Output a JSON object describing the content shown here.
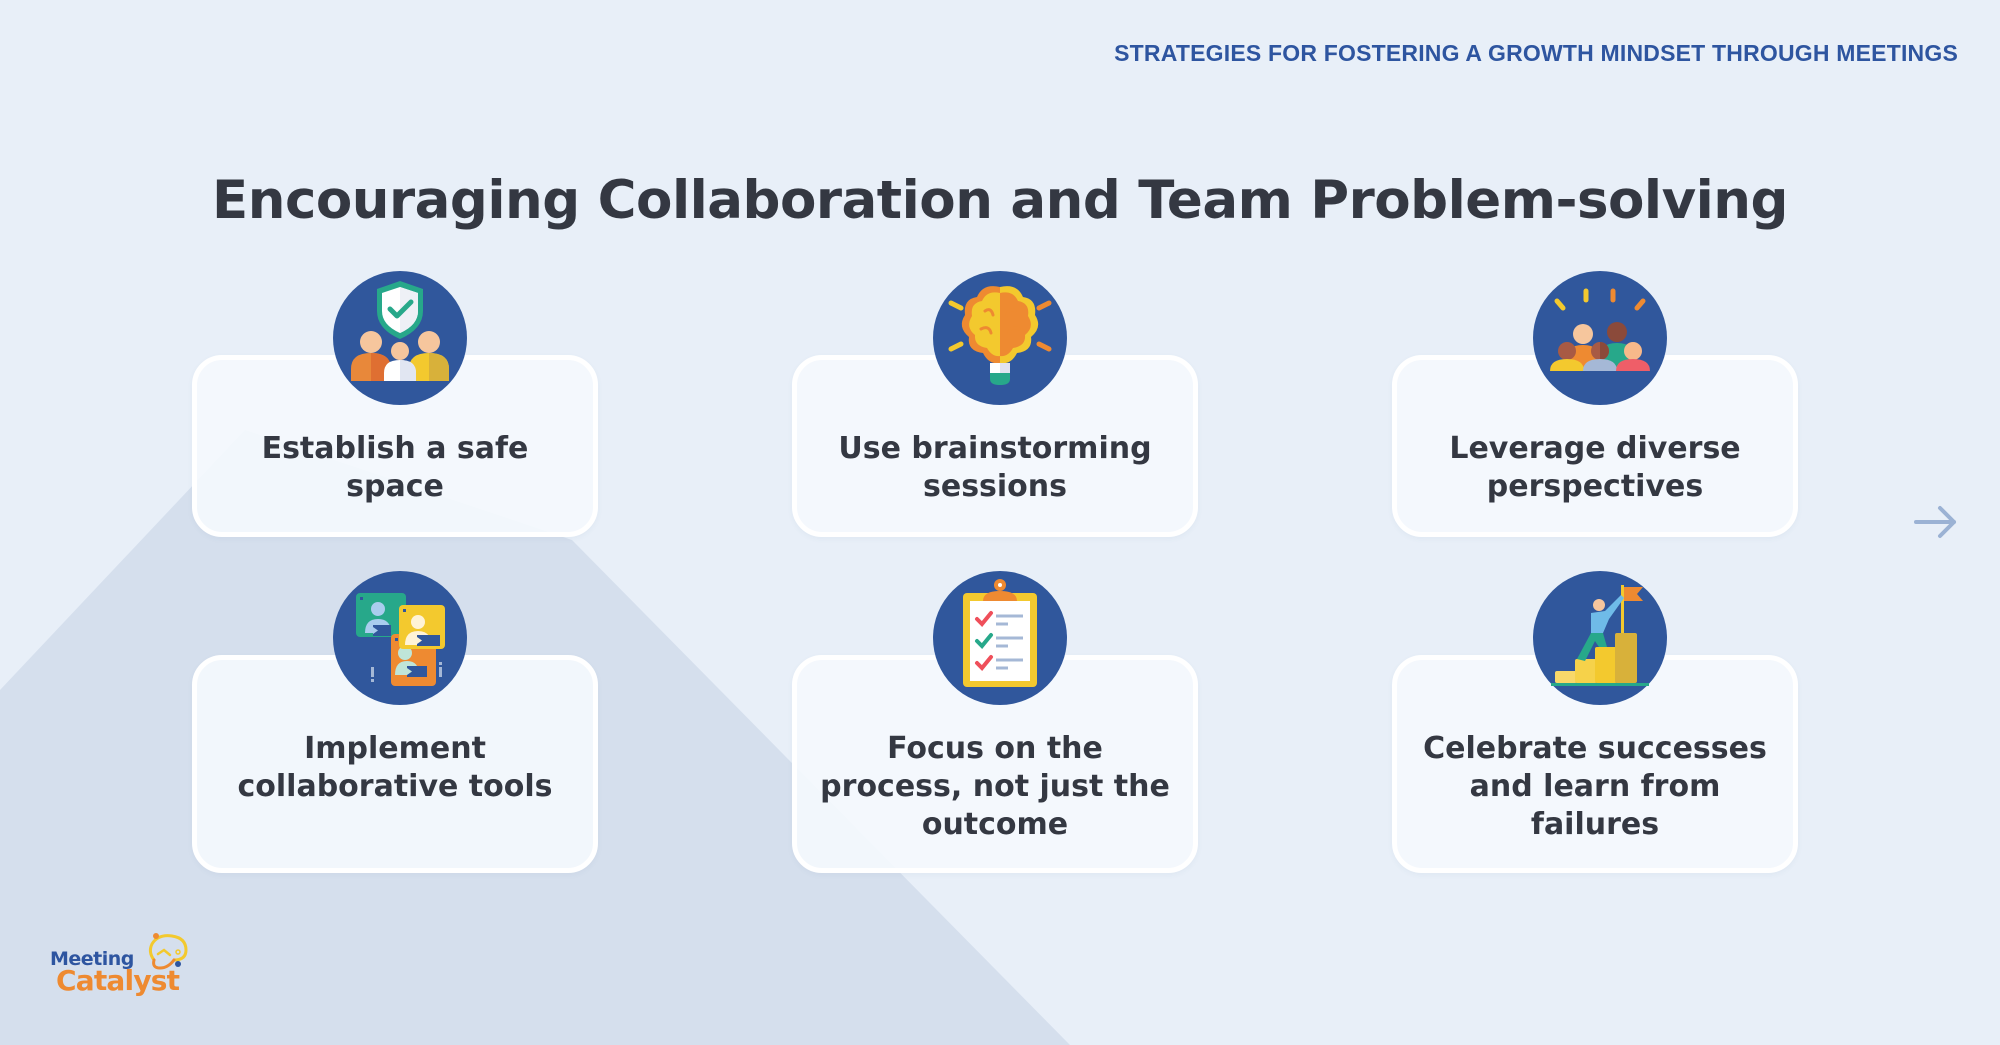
{
  "header": {
    "kicker": "STRATEGIES FOR FOSTERING A GROWTH MINDSET THROUGH MEETINGS",
    "title": "Encouraging Collaboration and Team Problem-solving"
  },
  "colors": {
    "background": "#e8eff8",
    "background_shape": "#d5dfed",
    "kicker": "#2e55a0",
    "title_text": "#343842",
    "icon_circle": "#30579c",
    "card_fill": "#f4f8fd",
    "card_border": "#ffffff",
    "arrow": "#9bb2d4",
    "logo_blue": "#2e55a0",
    "logo_orange": "#ee8a31"
  },
  "cards": [
    {
      "label": "Establish a safe\nspace",
      "icon": "shield-team-icon"
    },
    {
      "label": "Use brainstorming\nsessions",
      "icon": "brain-lightbulb-icon"
    },
    {
      "label": "Leverage diverse\nperspectives",
      "icon": "diverse-group-icon"
    },
    {
      "label": "Implement\ncollaborative tools",
      "icon": "video-call-icon"
    },
    {
      "label": "Focus on the\nprocess, not just the\noutcome",
      "icon": "checklist-clipboard-icon"
    },
    {
      "label": "Celebrate successes\nand learn from\nfailures",
      "icon": "climb-flag-icon"
    }
  ],
  "navigation": {
    "next_icon": "arrow-right-icon"
  },
  "logo": {
    "line1": "Meeting",
    "line2": "Catalyst"
  }
}
